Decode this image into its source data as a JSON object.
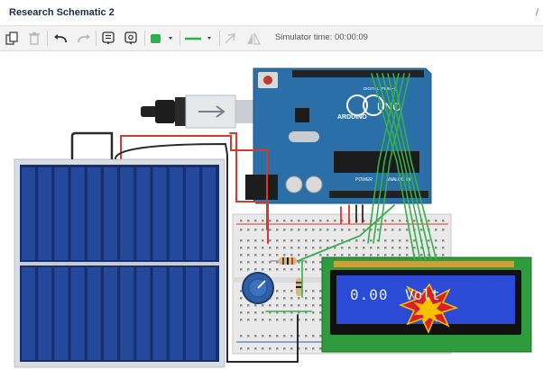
{
  "window": {
    "title": "Research Schematic 2",
    "edge_glyph": "/"
  },
  "toolbar": {
    "simulator_time_label": "Simulator time: 00:00:09",
    "fill_color": "#2bb24c",
    "line_color": "#2bb24c"
  },
  "components": {
    "lcd_display_value": "0.00",
    "lcd_display_unit": "Volt",
    "arduino_brand": "ARDUINO",
    "arduino_model": "UNO",
    "power_label": "POWER",
    "analog_label": "ANALOG IN",
    "digital_label": "DIGITAL (PWM~)"
  },
  "colors": {
    "arduino_board": "#2a6fa8",
    "lcd_pcb": "#2e9b3c",
    "lcd_screen": "#2b4bd6",
    "solar_cell": "#1d3e88",
    "wire_green": "#35b04a",
    "wire_red": "#d23b2e",
    "wire_black": "#2a2a2a"
  }
}
